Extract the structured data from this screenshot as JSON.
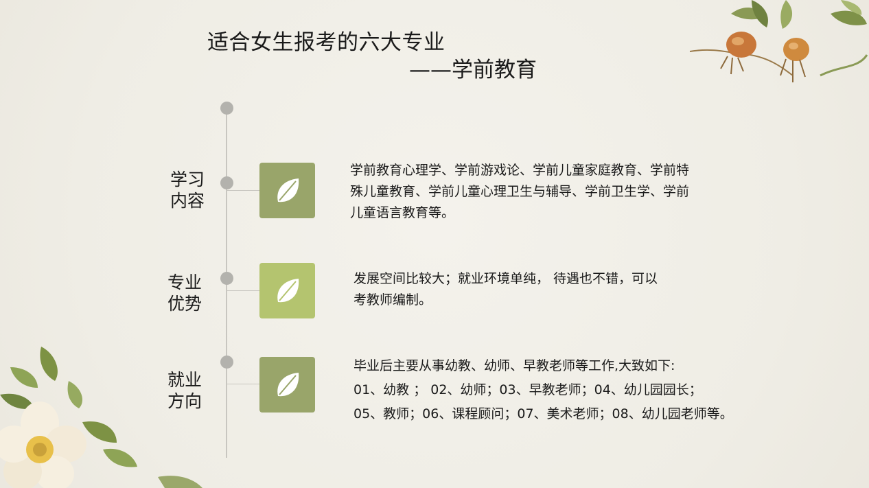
{
  "title": "适合女生报考的六大专业",
  "subtitle": "——学前教育",
  "colors": {
    "background": "#f1efe8",
    "timeline": "#c8c6c0",
    "dot": "#b3b2ad",
    "leaf_box_dark": "#99a56a",
    "leaf_box_light": "#b4c46f"
  },
  "sections": [
    {
      "label_line1": "学习",
      "label_line2": "内容",
      "icon": "leaf-icon",
      "lines": [
        "学前教育心理学、学前游戏论、学前儿童家庭教育、学前特",
        "殊儿童教育、学前儿童心理卫生与辅导、学前卫生学、学前",
        "儿童语言教育等。"
      ]
    },
    {
      "label_line1": "专业",
      "label_line2": "优势",
      "icon": "leaf-icon",
      "lines": [
        "发展空间比较大；就业环境单纯， 待遇也不错，可以",
        "考教师编制。"
      ]
    },
    {
      "label_line1": "就业",
      "label_line2": "方向",
      "icon": "leaf-icon",
      "lines": [
        "毕业后主要从事幼教、幼师、早教老师等工作,大致如下:",
        "01、幼教 ； 02、幼师；03、早教老师；04、幼儿园园长；",
        "05、教师；06、课程顾问；07、美术老师；08、幼儿园老师等。"
      ]
    }
  ]
}
